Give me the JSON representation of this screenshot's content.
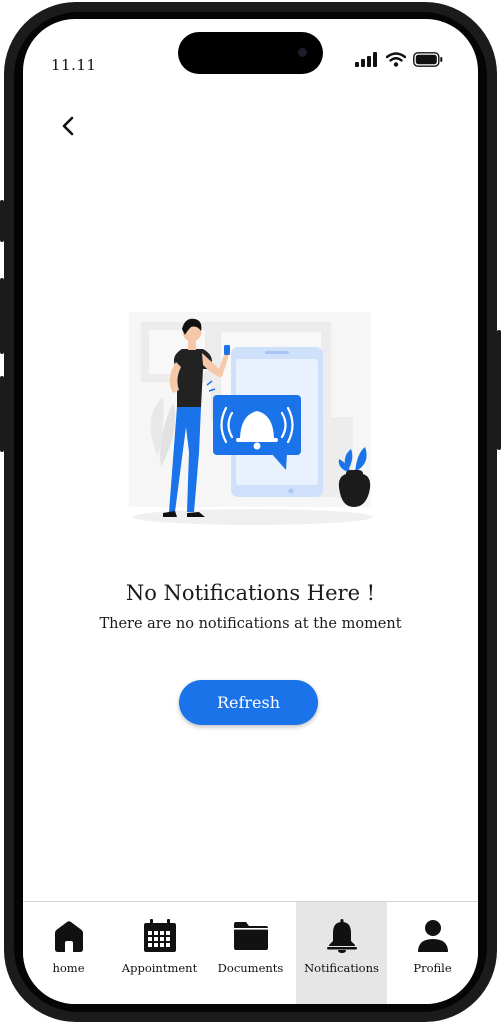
{
  "status_bar": {
    "time": "11.11",
    "icons": [
      "cellular-signal-icon",
      "wifi-icon",
      "battery-icon"
    ]
  },
  "nav": {
    "back_icon": "chevron-left-icon"
  },
  "empty_state": {
    "illustration": "person-with-phone-notification-bell-illustration",
    "title": "No Notifications Here !",
    "subtitle": "There are no notifications at the moment",
    "refresh_label": "Refresh"
  },
  "tabbar": {
    "items": [
      {
        "label": "home",
        "icon": "home-icon",
        "active": false
      },
      {
        "label": "Appointment",
        "icon": "calendar-icon",
        "active": false
      },
      {
        "label": "Documents",
        "icon": "folder-icon",
        "active": false
      },
      {
        "label": "Notifications",
        "icon": "bell-icon",
        "active": true
      },
      {
        "label": "Profile",
        "icon": "user-icon",
        "active": false
      }
    ]
  },
  "colors": {
    "accent": "#1a73e8",
    "active_tab_bg": "#e6e6e6",
    "text": "#1a1a1a"
  }
}
